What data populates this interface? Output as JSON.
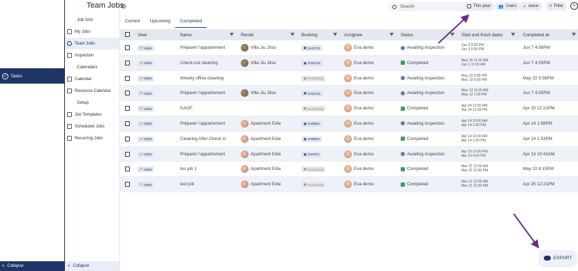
{
  "sidebar_left": {
    "tasks_label": "Tasks",
    "collapse_label": "Collapse"
  },
  "nav": {
    "section_job_lists": "Job lists",
    "my_jobs": "My Jobs",
    "team_jobs": "Team Jobs",
    "inspection": "Inspection",
    "section_calendars": "Calendars",
    "calendar": "Calendar",
    "resource_calendar": "Resource Calendar",
    "section_setup": "Setup",
    "job_templates": "Job Templates",
    "scheduled_jobs": "Scheduled Jobs",
    "recurring_jobs": "Recurring Jobs",
    "collapse_label": "Collapse"
  },
  "header": {
    "title": "Team Jobs",
    "search_placeholder": "Search",
    "filter_this_year": "This year",
    "filter_users": "Users",
    "filter_admin": "Admin",
    "filter_label": "Filter",
    "close": "×"
  },
  "tabs": [
    "Current",
    "Upcoming",
    "Completed"
  ],
  "columns": {
    "view": "View",
    "name": "Name",
    "rental": "Rental",
    "booking": "Booking",
    "assignee": "Assignee",
    "status": "Status",
    "dates": "Start and finish dates",
    "completed_at": "Completed at"
  },
  "rows": [
    {
      "view": "VIEW",
      "name": "Préparer l'appartement",
      "rental": "Villa Jiu Jitsu",
      "booking": "SAPYTS",
      "assignee": "Eva demo",
      "status": "Awaiting inspection",
      "start": "Jun 3 3:00 PM",
      "finish": "Jun 3 5:00 PM",
      "completed": "Jun 7 4:08PM"
    },
    {
      "view": "VIEW",
      "name": "Check-out cleaning",
      "rental": "Villa Jiu Jitsu",
      "booking": "OANCGL",
      "assignee": "Eva demo",
      "status": "Completed",
      "start": "May 30 11:00 AM",
      "finish": "Jun 1 11:00 AM",
      "completed": "Jun 7 4:03PM"
    },
    {
      "view": "VIEW",
      "name": "Weekly office cleaning",
      "rental": "",
      "booking": "No Booking",
      "assignee": "Eva demo",
      "status": "Awaiting inspection",
      "start": "May 19 3:00 PM",
      "finish": "May 19 5:00 PM",
      "completed": "May 22 5:58PM"
    },
    {
      "view": "VIEW",
      "name": "Préparer l'appartement",
      "rental": "Villa Jiu Jitsu",
      "booking": "OANCGL",
      "assignee": "Eva demo",
      "status": "Awaiting inspection",
      "start": "May 13 11:00 AM",
      "finish": "May 13 1:00 PM",
      "completed": "Jun 7 4:05PM"
    },
    {
      "view": "VIEW",
      "name": "fcAGF",
      "rental": "",
      "booking": "No Booking",
      "assignee": "Eva demo",
      "status": "Completed",
      "start": "Apr 24 12:00 AM",
      "finish": "Apr 24 11:59 PM",
      "completed": "Apr 25 12:21PM"
    },
    {
      "view": "VIEW",
      "name": "Préparer l'appartement",
      "rental": "Apartment Edie",
      "booking": "0AM0N4",
      "assignee": "Eva demo",
      "status": "Awaiting inspection",
      "start": "Apr 14 10:00 AM",
      "finish": "Apr 14 1:00 PM",
      "completed": "Apr 14 1:58PM"
    },
    {
      "view": "VIEW",
      "name": "Cleaning After Check in",
      "rental": "Apartment Edie",
      "booking": "0AM0N4",
      "assignee": "Eva demo",
      "status": "Completed",
      "start": "Apr 14 10:00 AM",
      "finish": "Apr 14 1:00 PM",
      "completed": "Apr 14 1:53PM"
    },
    {
      "view": "VIEW",
      "name": "Préparer l'appartement",
      "rental": "Apartment Edie",
      "booking": "0AHFK4",
      "assignee": "Eva demo",
      "status": "Awaiting inspection",
      "start": "Apr 10 10:00 PM",
      "finish": "Apr 10 4:25 PM",
      "completed": "Apr 13 10:42AM"
    },
    {
      "view": "VIEW",
      "name": "tes job 1",
      "rental": "Apartment Edie",
      "booking": "No Booking",
      "assignee": "Eva demo",
      "status": "Completed",
      "start": "Mar 22 12:00 AM",
      "finish": "Mar 22 11:59 PM",
      "completed": "May 22 6:15PM"
    },
    {
      "view": "VIEW",
      "name": "test job",
      "rental": "Apartment Edie",
      "booking": "No Booking",
      "assignee": "Eva demo",
      "status": "Completed",
      "start": "Mar 21 12:00 AM",
      "finish": "Mar 21 11:59 PM",
      "completed": "Apr 25 12:21PM"
    }
  ],
  "export_label": "EXPORT",
  "colors": {
    "navy": "#1f3566",
    "completed": "#3a9d5a",
    "arrow": "#6a2d8a"
  }
}
